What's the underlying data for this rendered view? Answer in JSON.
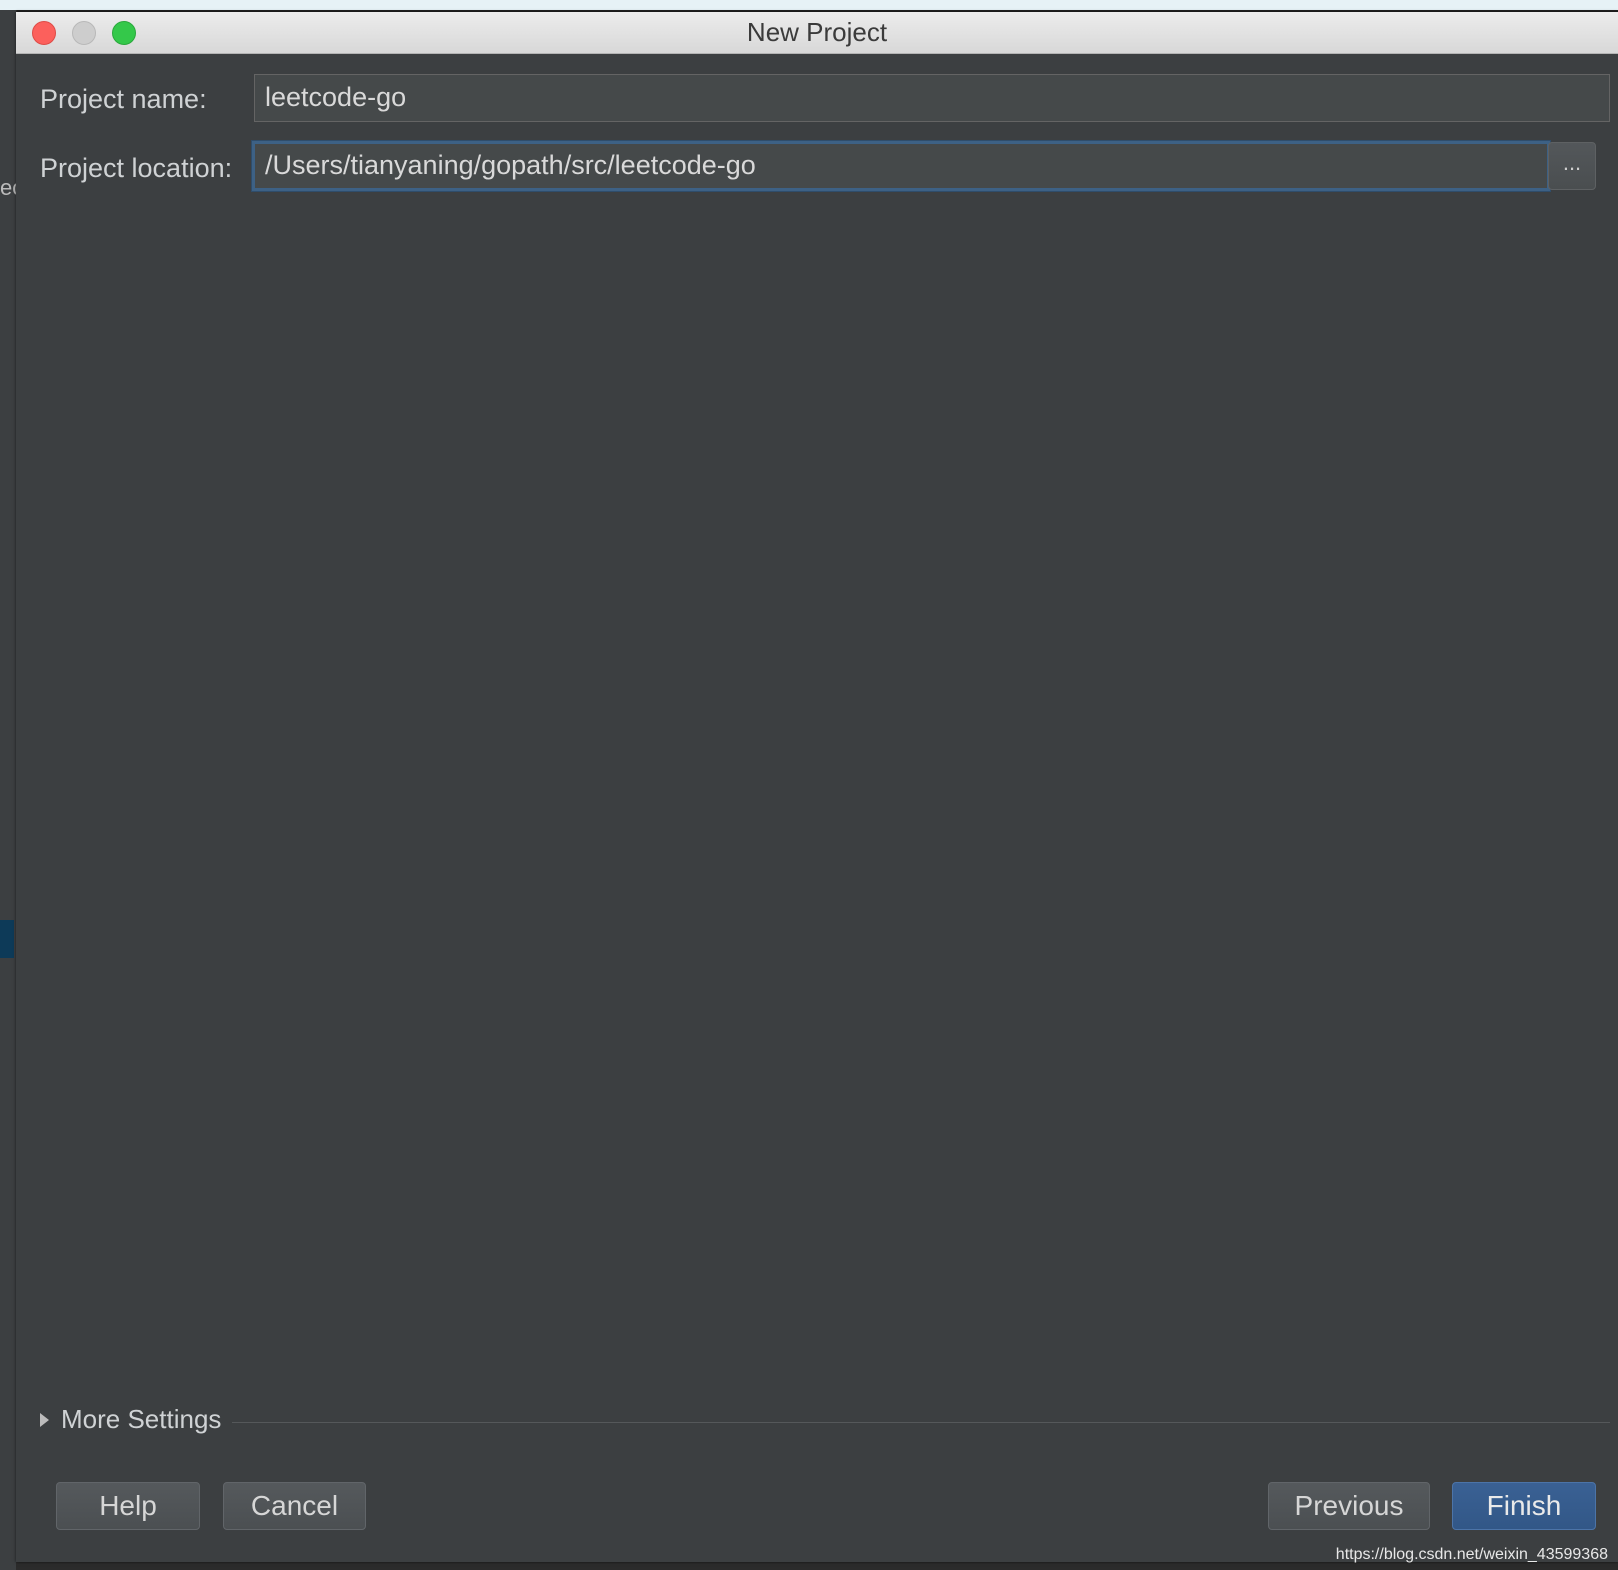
{
  "window": {
    "title": "New Project"
  },
  "form": {
    "project_name_label": "Project name:",
    "project_name_value": "leetcode-go",
    "project_location_label": "Project location:",
    "project_location_value": "/Users/tianyaning/gopath/src/leetcode-go",
    "browse_label": "..."
  },
  "more_settings": {
    "label": "More Settings",
    "icon": "triangle-right-icon"
  },
  "buttons": {
    "help": "Help",
    "cancel": "Cancel",
    "previous": "Previous",
    "finish": "Finish"
  },
  "background": {
    "left_fragment": "ec"
  },
  "watermark": "https://blog.csdn.net/weixin_43599368",
  "colors": {
    "dialog_bg": "#3c3f41",
    "focus_border": "#3d6185",
    "primary_button": "#365c8d",
    "close_light": "#fc605c",
    "minimize_light": "#cdcdcd",
    "zoom_light": "#34c84a"
  }
}
